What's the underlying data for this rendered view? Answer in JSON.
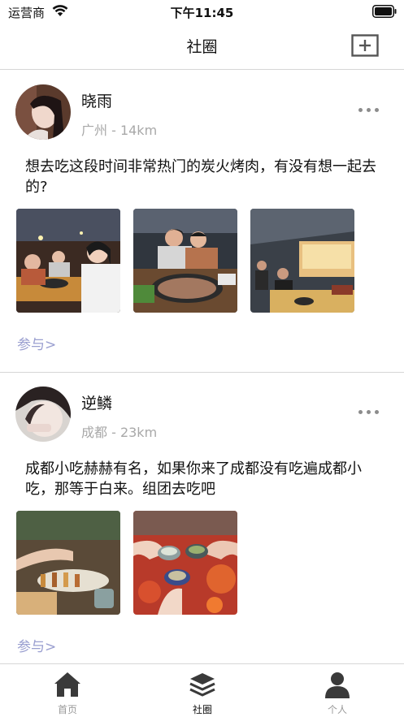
{
  "status_bar": {
    "carrier": "运营商",
    "time": "下午11:45"
  },
  "nav": {
    "title": "社圈",
    "add_icon": "plus-square-icon"
  },
  "posts": [
    {
      "username": "晓雨",
      "location": "广州",
      "distance": "14km",
      "meta": "广州 - 14km",
      "content": "想去吃这段时间非常热门的炭火烤肉，有没有想一起去的?",
      "photos": [
        "bbq-friends-photo",
        "bbq-grill-photo",
        "bbq-restaurant-photo"
      ],
      "join_label": "参与>"
    },
    {
      "username": "逆鳞",
      "location": "成都",
      "distance": "23km",
      "meta": "成都 - 23km",
      "content": "成都小吃赫赫有名，如果你来了成都没有吃遍成都小吃，那等于白来。组团去吃吧",
      "photos": [
        "skewers-photo",
        "hotpot-toast-photo"
      ],
      "join_label": "参与>"
    }
  ],
  "tabs": [
    {
      "label": "首页",
      "icon": "home-icon",
      "active": false
    },
    {
      "label": "社圈",
      "icon": "layers-icon",
      "active": true
    },
    {
      "label": "个人",
      "icon": "person-icon",
      "active": false
    }
  ],
  "colors": {
    "accent_link": "#9a9fd0",
    "meta_text": "#a8a8a8",
    "divider": "#d6d6d6",
    "tab_inactive": "#9a9a9a",
    "icon_dark": "#3a3a3a"
  }
}
